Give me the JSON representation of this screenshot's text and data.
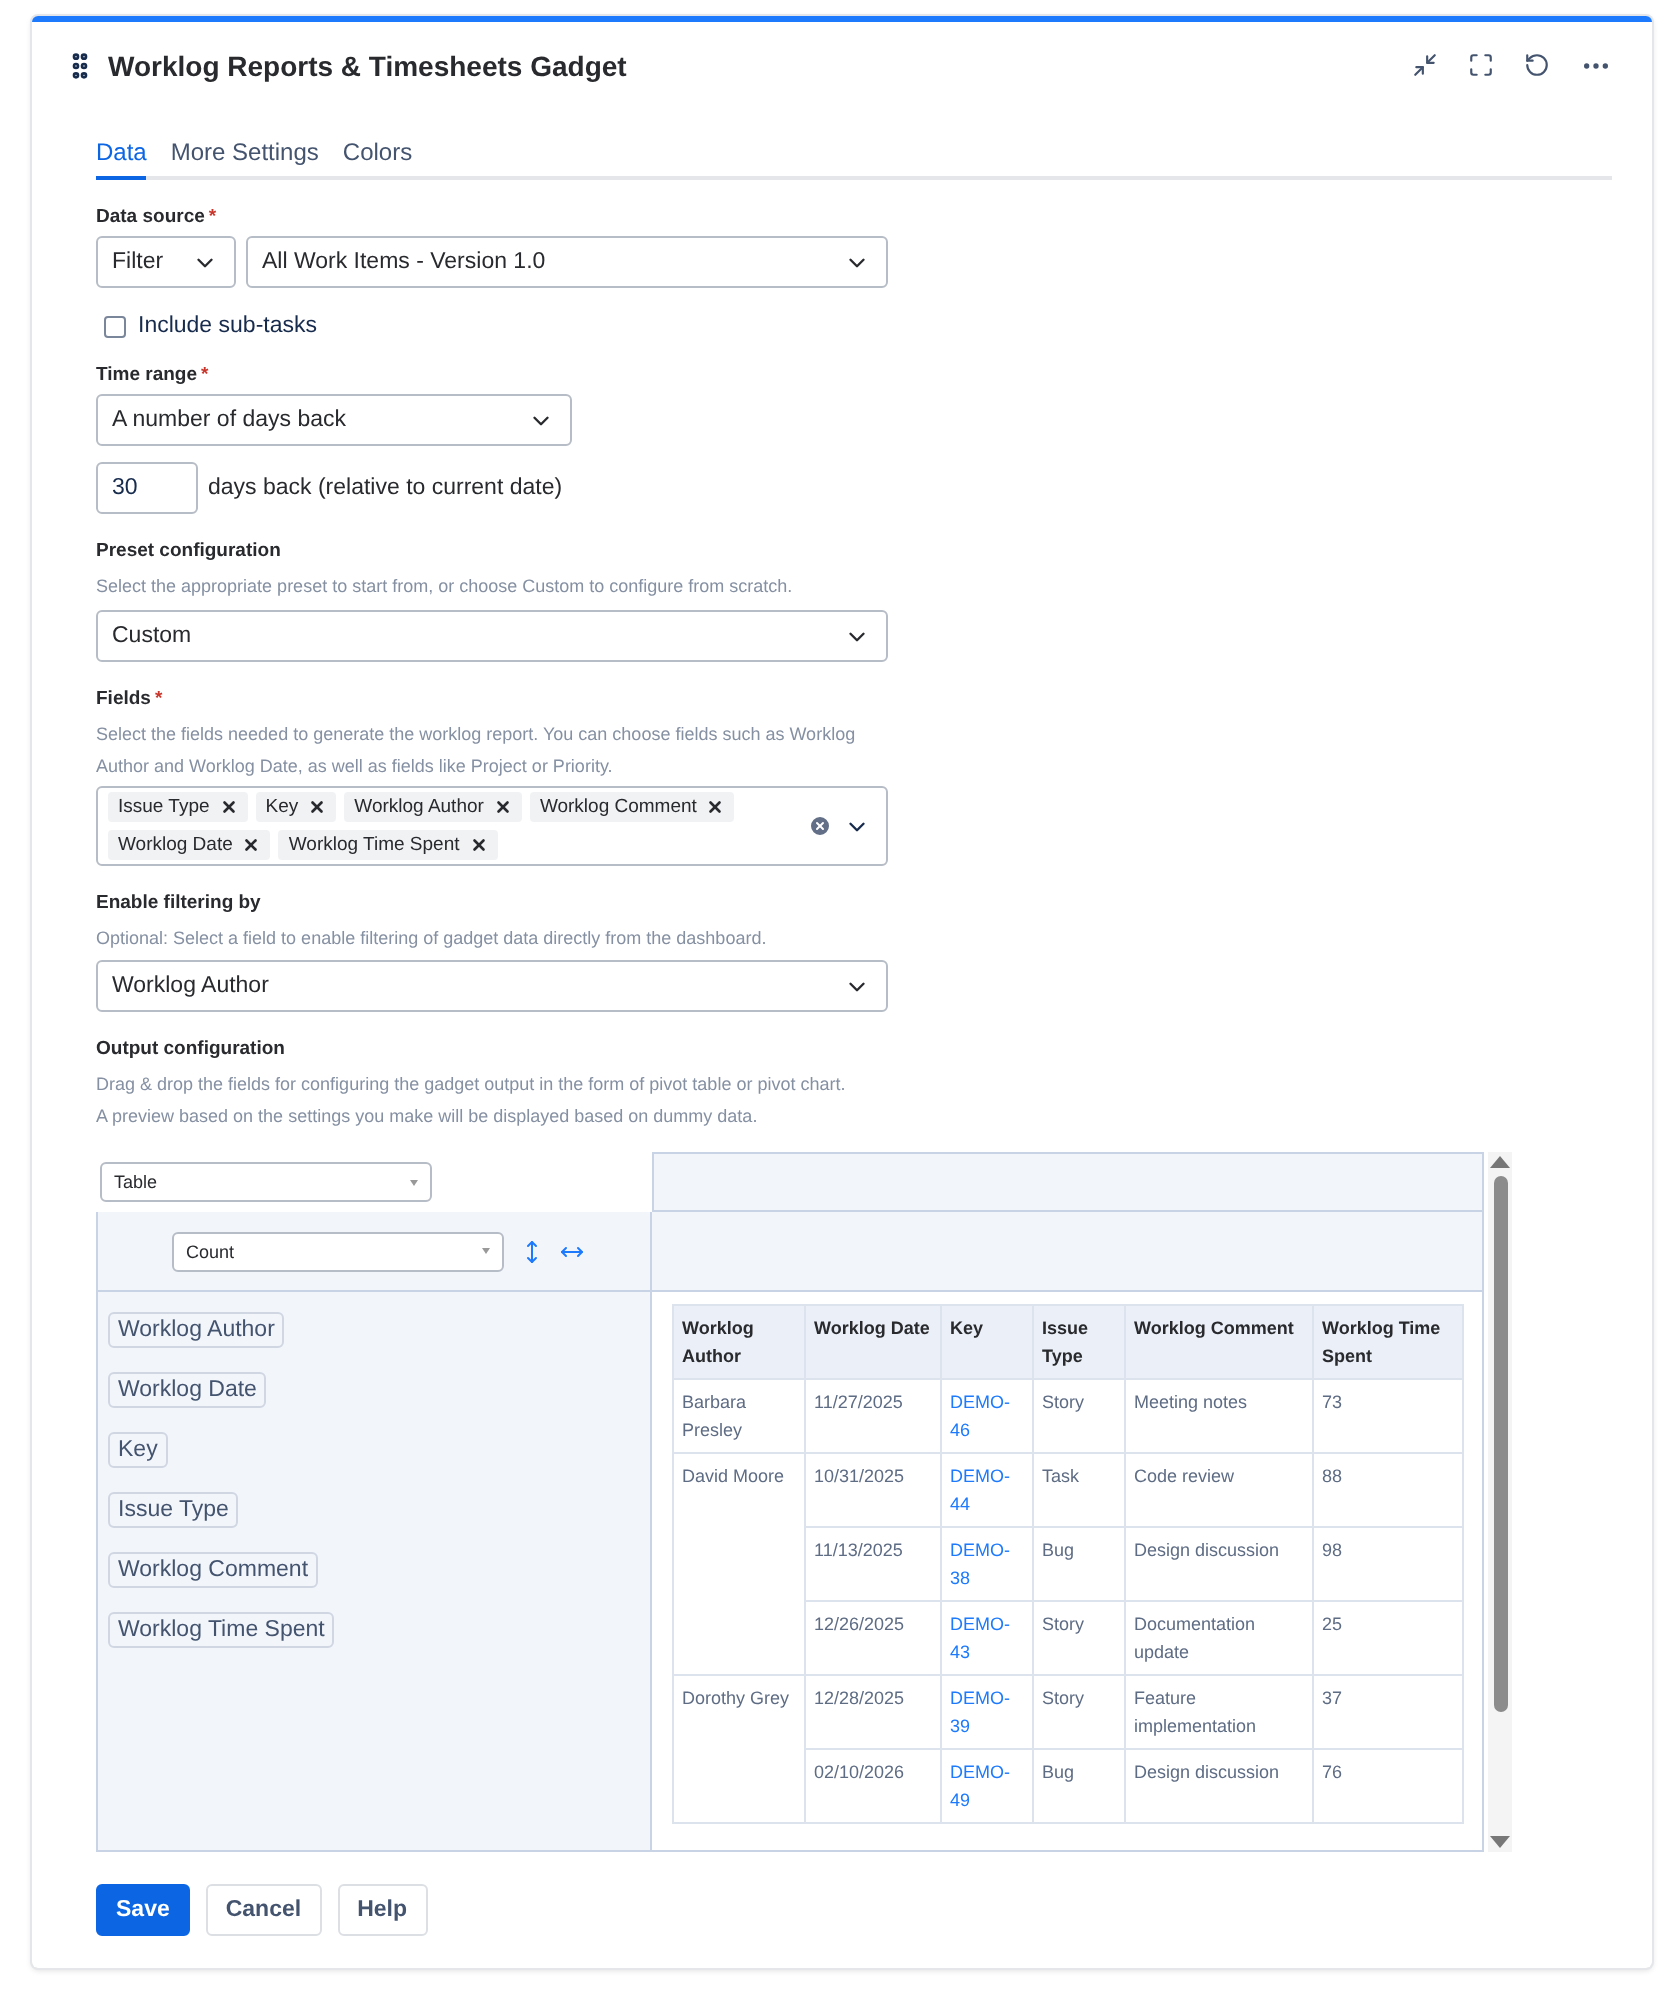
{
  "header": {
    "title": "Worklog Reports & Timesheets Gadget"
  },
  "tabs": [
    {
      "label": "Data",
      "selected": true
    },
    {
      "label": "More Settings",
      "selected": false
    },
    {
      "label": "Colors",
      "selected": false
    }
  ],
  "data_source": {
    "label": "Data source",
    "required": "*",
    "type_value": "Filter",
    "source_value": "All Work Items - Version 1.0"
  },
  "include_subtasks": {
    "label": "Include sub-tasks",
    "checked": false
  },
  "time_range": {
    "label": "Time range",
    "required": "*",
    "value": "A number of days back"
  },
  "days": {
    "value": "30",
    "suffix": "days back (relative to current date)"
  },
  "preset": {
    "label": "Preset configuration",
    "hint": "Select the appropriate preset to start from, or choose Custom to configure from scratch.",
    "value": "Custom"
  },
  "fields": {
    "label": "Fields",
    "required": "*",
    "hint": "Select the fields needed to generate the worklog report. You can choose fields such as Worklog Author and Worklog Date, as well as fields like Project or Priority.",
    "tags": [
      "Issue Type",
      "Key",
      "Worklog Author",
      "Worklog Comment",
      "Worklog Date",
      "Worklog Time Spent"
    ]
  },
  "filtering": {
    "label": "Enable filtering by",
    "hint": "Optional: Select a field to enable filtering of gadget data directly from the dashboard.",
    "value": "Worklog Author"
  },
  "output": {
    "label": "Output configuration",
    "hints": [
      "Drag & drop the fields for configuring the gadget output in the form of pivot table or pivot chart.",
      "A preview based on the settings you make will be displayed based on dummy data."
    ],
    "renderer": "Table",
    "aggregator": "Count",
    "field_chips": [
      "Worklog Author",
      "Worklog Date",
      "Key",
      "Issue Type",
      "Worklog Comment",
      "Worklog Time Spent"
    ],
    "table": {
      "columns": [
        "Worklog Author",
        "Worklog Date",
        "Key",
        "Issue Type",
        "Worklog Comment",
        "Worklog Time Spent"
      ],
      "rows": [
        {
          "author": "Barbara Presley",
          "entries": [
            {
              "date": "11/27/2025",
              "key": "DEMO-46",
              "type": "Story",
              "comment": "Meeting notes",
              "time": "73"
            }
          ]
        },
        {
          "author": "David Moore",
          "entries": [
            {
              "date": "10/31/2025",
              "key": "DEMO-44",
              "type": "Task",
              "comment": "Code review",
              "time": "88"
            },
            {
              "date": "11/13/2025",
              "key": "DEMO-38",
              "type": "Bug",
              "comment": "Design discussion",
              "time": "98"
            },
            {
              "date": "12/26/2025",
              "key": "DEMO-43",
              "type": "Story",
              "comment": "Documentation update",
              "time": "25"
            }
          ]
        },
        {
          "author": "Dorothy Grey",
          "entries": [
            {
              "date": "12/28/2025",
              "key": "DEMO-39",
              "type": "Story",
              "comment": "Feature implementation",
              "time": "37"
            },
            {
              "date": "02/10/2026",
              "key": "DEMO-49",
              "type": "Bug",
              "comment": "Design discussion",
              "time": "76"
            }
          ]
        }
      ]
    }
  },
  "buttons": [
    {
      "label": "Save",
      "kind": "primary"
    },
    {
      "label": "Cancel",
      "kind": "default"
    },
    {
      "label": "Help",
      "kind": "default"
    }
  ]
}
